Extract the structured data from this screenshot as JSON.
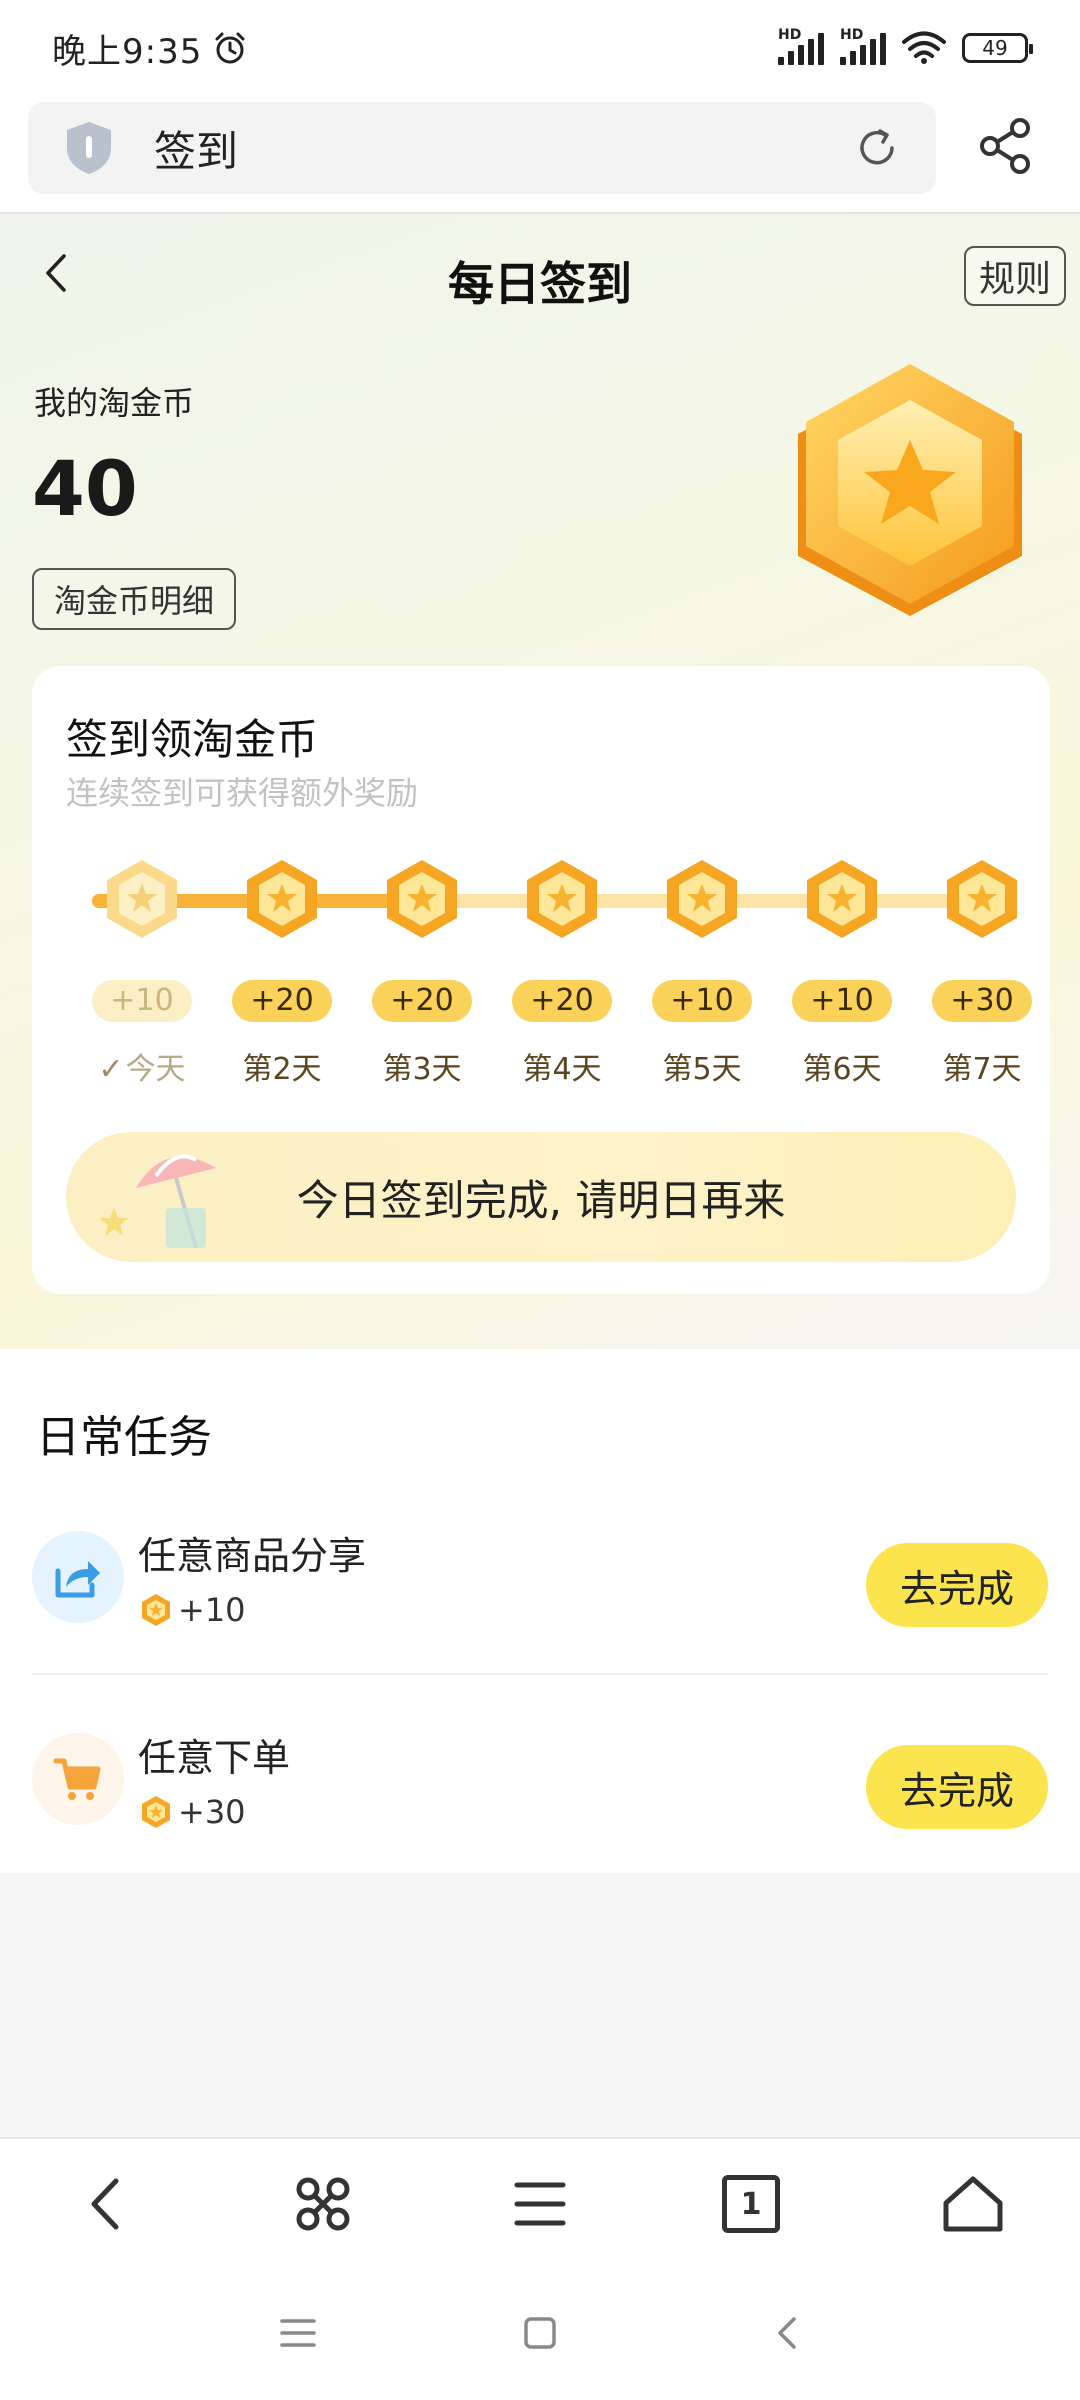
{
  "status_bar": {
    "time": "晚上9:35",
    "hd1": "HD",
    "hd2": "HD",
    "battery": "49"
  },
  "browser": {
    "address_text": "签到"
  },
  "header": {
    "title": "每日签到",
    "rules_label": "规则"
  },
  "wallet": {
    "label": "我的淘金币",
    "value": "40",
    "detail_button": "淘金币明细"
  },
  "checkin": {
    "title": "签到领淘金币",
    "subtitle": "连续签到可获得额外奖励",
    "days": [
      {
        "points": "+10",
        "label": "今天",
        "checked": true
      },
      {
        "points": "+20",
        "label": "第2天"
      },
      {
        "points": "+20",
        "label": "第3天"
      },
      {
        "points": "+20",
        "label": "第4天"
      },
      {
        "points": "+10",
        "label": "第5天"
      },
      {
        "points": "+10",
        "label": "第6天"
      },
      {
        "points": "+30",
        "label": "第7天"
      }
    ],
    "check_mark": "✓",
    "done_message": "今日签到完成, 请明日再来"
  },
  "tasks": {
    "title": "日常任务",
    "items": [
      {
        "name": "任意商品分享",
        "reward": "+10",
        "button": "去完成",
        "icon": "share-icon"
      },
      {
        "name": "任意下单",
        "reward": "+30",
        "button": "去完成",
        "icon": "cart-icon"
      }
    ]
  },
  "toolbar": {
    "tab_count": "1"
  },
  "colors": {
    "accent_yellow": "#fbe44e",
    "coin_orange": "#f7b23a",
    "points_pill": "#fad25a"
  }
}
